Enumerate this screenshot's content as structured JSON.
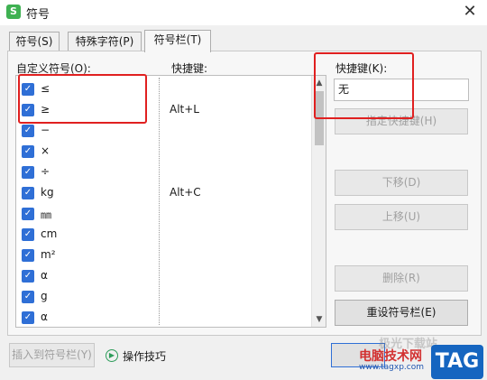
{
  "window": {
    "title": "符号",
    "app_icon_letter": "S"
  },
  "tabs": [
    {
      "label": "符号(S)"
    },
    {
      "label": "特殊字符(P)"
    },
    {
      "label": "符号栏(T)"
    }
  ],
  "custom_list": {
    "label": "自定义符号(O):",
    "shortcut_column_label": "快捷键:",
    "rows": [
      {
        "symbol": "≤",
        "shortcut": "",
        "checked": true
      },
      {
        "symbol": "≥",
        "shortcut": "Alt+L",
        "checked": true
      },
      {
        "symbol": "−",
        "shortcut": "",
        "checked": true
      },
      {
        "symbol": "×",
        "shortcut": "",
        "checked": true
      },
      {
        "symbol": "÷",
        "shortcut": "",
        "checked": true
      },
      {
        "symbol": "kg",
        "shortcut": "Alt+C",
        "checked": true
      },
      {
        "symbol": "㎜",
        "shortcut": "",
        "checked": true
      },
      {
        "symbol": "cm",
        "shortcut": "",
        "checked": true
      },
      {
        "symbol": "m²",
        "shortcut": "",
        "checked": true
      },
      {
        "symbol": "α",
        "shortcut": "",
        "checked": true
      },
      {
        "symbol": "g",
        "shortcut": "",
        "checked": true
      },
      {
        "symbol": "α",
        "shortcut": "",
        "checked": true
      }
    ]
  },
  "shortcut_panel": {
    "label": "快捷键(K):",
    "value": "无",
    "assign_button": "指定快捷键(H)",
    "move_down_button": "下移(D)",
    "move_up_button": "上移(U)",
    "delete_button": "删除(R)",
    "reset_button": "重设符号栏(E)"
  },
  "footer": {
    "insert_button": "插入到符号栏(Y)",
    "tips_link": "操作技巧"
  },
  "watermark": {
    "faded": "极光下载站",
    "text": "电脑技术网",
    "url": "www.tagxp.com",
    "tag": "TAG"
  }
}
